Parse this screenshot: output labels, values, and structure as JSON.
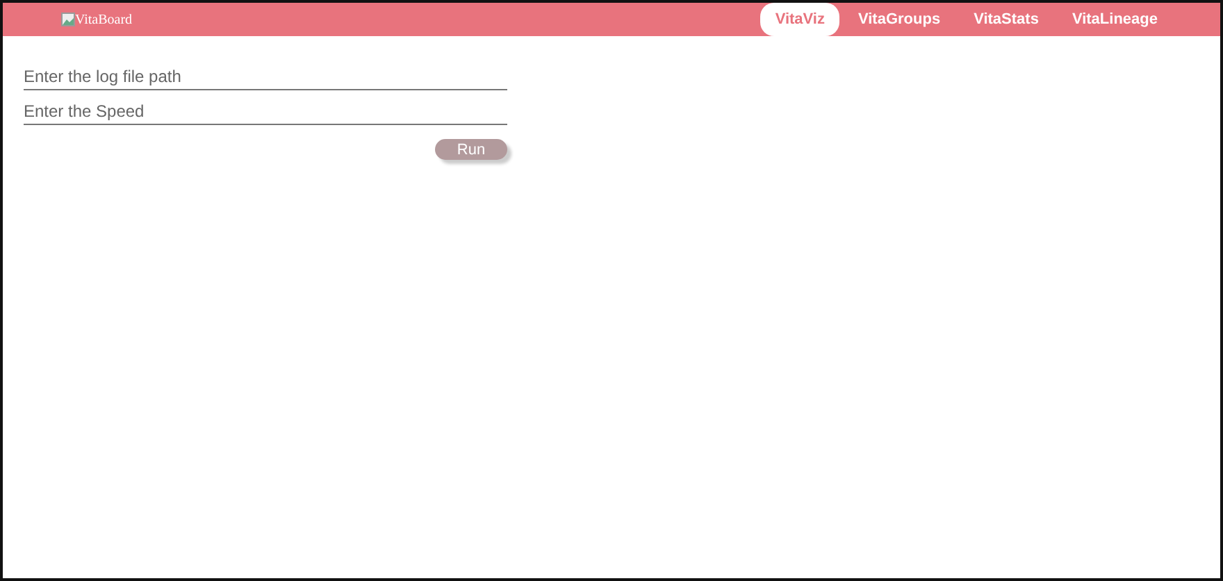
{
  "logo": {
    "alt_text": "VitaBoard"
  },
  "nav": [
    {
      "label": "VitaViz",
      "selected": true
    },
    {
      "label": "VitaGroups",
      "selected": false
    },
    {
      "label": "VitaStats",
      "selected": false
    },
    {
      "label": "VitaLineage",
      "selected": false
    }
  ],
  "form": {
    "fields": [
      {
        "placeholder": "Enter the log file path"
      },
      {
        "placeholder": "Enter the Speed"
      }
    ],
    "button": "Run"
  }
}
